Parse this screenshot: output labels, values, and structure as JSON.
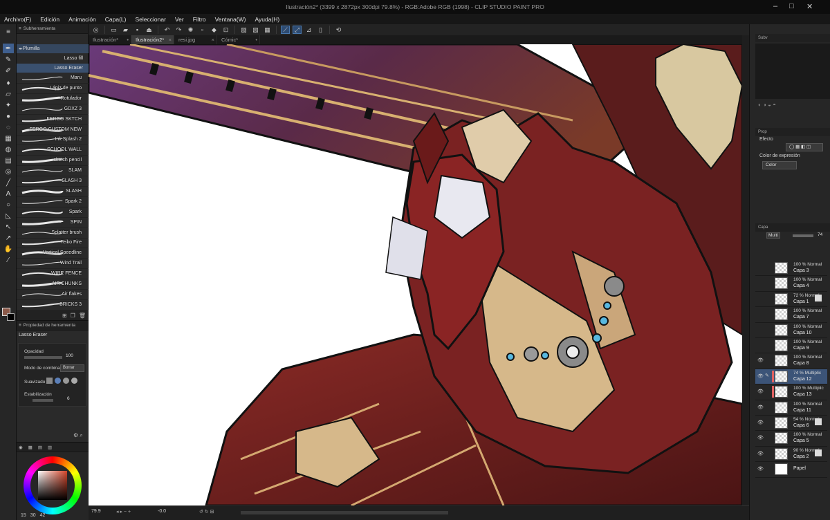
{
  "window": {
    "title": "Ilustración2* (3399 x 2872px 300dpi 79.8%) - RGB:Adobe RGB (1998) - CLIP STUDIO PAINT PRO",
    "controls": [
      "–",
      "□",
      "✕"
    ]
  },
  "menu": [
    "Archivo(F)",
    "Edición",
    "Animación",
    "Capa(L)",
    "Seleccionar",
    "Ver",
    "Filtro",
    "Ventana(W)",
    "Ayuda(H)"
  ],
  "tabs": [
    {
      "label": "Ilustración*",
      "active": false
    },
    {
      "label": "Ilustración2*",
      "active": true
    },
    {
      "label": "resi.jpg",
      "active": false
    },
    {
      "label": "Cómic*",
      "active": false
    }
  ],
  "subtool": {
    "header": "Subherramienta",
    "groups": [
      "Plumilla",
      "Lasso fill",
      "Lasso Eraser"
    ],
    "brushes": [
      "Maru",
      "Lápiz de punto",
      "Rotulador",
      "GDXZ 3",
      "FERGO SKTCH",
      "FERGO CUSTOM NEW",
      "Ink Splash 2",
      "SCHOOL WALL",
      "sketch pencil",
      "SLAM",
      "SLASH 3",
      "SLASH",
      "Spark 2",
      "Spark",
      "SPIN",
      "Splatter brush",
      "Teiko Fire",
      "Vertical Speedline",
      "Wind Trail",
      "WIRE FENCE",
      "AIR CHUNKS",
      "Air flakes",
      "BRICKS 3"
    ]
  },
  "tool_property": {
    "header": "Propiedad de herramienta",
    "name": "Lasso Eraser",
    "opacity_label": "Opacidad",
    "opacity_value": "100",
    "blend_label": "Modo de combinac",
    "blend_value": "Borrar",
    "smoothing_label": "Suavizado",
    "stabilization_label": "Estabilización",
    "stabilization_value": "6"
  },
  "color_panel": {
    "main_color": "#8c5a4a",
    "sub_color": "#000000",
    "footer_values": [
      "15",
      "30",
      "42"
    ]
  },
  "status": {
    "zoom": "79.9",
    "rotation": "-0.0"
  },
  "right_panel": {
    "sub_tab": "Subv",
    "property_tab": "Prop",
    "effect_label": "Efecto",
    "expression_label": "Color de expresión",
    "expression_value": "Color",
    "layer_tab": "Capa",
    "blend_mode": "Multi",
    "opacity": "74"
  },
  "layers": [
    {
      "mode": "100 % Normal",
      "name": "Capa 3",
      "visible": false,
      "selected": false,
      "mask": false,
      "paper": false
    },
    {
      "mode": "100 % Normal",
      "name": "Capa 4",
      "visible": false,
      "selected": false,
      "mask": false,
      "paper": false
    },
    {
      "mode": "72 % Normal",
      "name": "Capa 1",
      "visible": false,
      "selected": false,
      "mask": true,
      "paper": false
    },
    {
      "mode": "100 % Normal",
      "name": "Capa 7",
      "visible": false,
      "selected": false,
      "mask": false,
      "paper": false
    },
    {
      "mode": "100 % Normal",
      "name": "Capa 10",
      "visible": false,
      "selected": false,
      "mask": false,
      "paper": false
    },
    {
      "mode": "100 % Normal",
      "name": "Capa 9",
      "visible": false,
      "selected": false,
      "mask": false,
      "paper": false
    },
    {
      "mode": "100 % Normal",
      "name": "Capa 8",
      "visible": true,
      "selected": false,
      "mask": false,
      "paper": false
    },
    {
      "mode": "74 % Multiplic",
      "name": "Capa 12",
      "visible": true,
      "selected": true,
      "mask": false,
      "paper": false
    },
    {
      "mode": "100 % Multiplic",
      "name": "Capa 13",
      "visible": true,
      "selected": false,
      "mask": false,
      "paper": false
    },
    {
      "mode": "100 % Normal",
      "name": "Capa 11",
      "visible": true,
      "selected": false,
      "mask": false,
      "paper": false
    },
    {
      "mode": "54 % Normal",
      "name": "Capa 6",
      "visible": true,
      "selected": false,
      "mask": true,
      "paper": false
    },
    {
      "mode": "100 % Normal",
      "name": "Capa 5",
      "visible": true,
      "selected": false,
      "mask": false,
      "paper": false
    },
    {
      "mode": "90 % Normal",
      "name": "Capa 2",
      "visible": true,
      "selected": false,
      "mask": true,
      "paper": false
    },
    {
      "mode": "",
      "name": "Papel",
      "visible": true,
      "selected": false,
      "mask": false,
      "paper": true
    }
  ],
  "colors": {
    "accent": "#3f5f8f",
    "canvas_bg": "#ffffff",
    "armor_red": "#7a1f1f",
    "fur_tan": "#d6b88a",
    "gem_blue": "#58b8e0"
  }
}
